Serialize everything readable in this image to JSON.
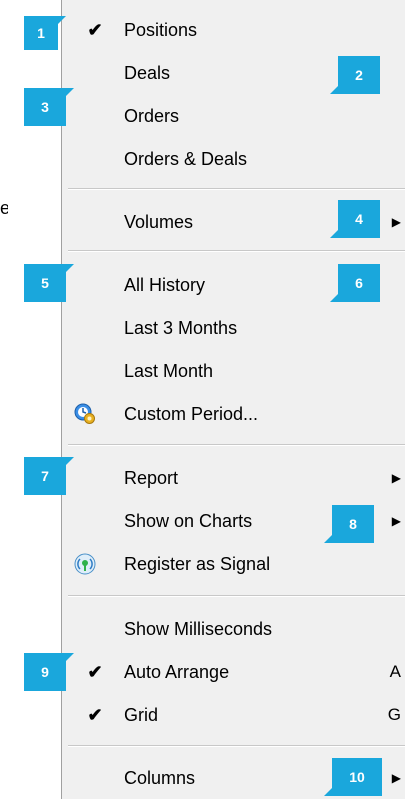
{
  "stray_text": "e",
  "menu": {
    "items": [
      {
        "label": "Positions",
        "checked": true
      },
      {
        "label": "Deals"
      },
      {
        "label": "Orders"
      },
      {
        "label": "Orders & Deals"
      },
      {
        "label": "Volumes",
        "submenu": true
      },
      {
        "label": "All History"
      },
      {
        "label": "Last 3 Months"
      },
      {
        "label": "Last Month"
      },
      {
        "label": "Custom Period...",
        "icon": "custom-period-gear-icon"
      },
      {
        "label": "Report",
        "submenu": true
      },
      {
        "label": "Show on Charts",
        "submenu": true
      },
      {
        "label": "Register as Signal",
        "icon": "signal-broadcast-icon"
      },
      {
        "label": "Show Milliseconds"
      },
      {
        "label": "Auto Arrange",
        "checked": true,
        "shortcut": "A"
      },
      {
        "label": "Grid",
        "checked": true,
        "shortcut": "G"
      },
      {
        "label": "Columns",
        "submenu": true
      }
    ],
    "check_glyph": "✔",
    "submenu_glyph": "▶"
  },
  "callouts": [
    "1",
    "2",
    "3",
    "4",
    "5",
    "6",
    "7",
    "8",
    "9",
    "10"
  ],
  "colors": {
    "callout": "#1aa7dc",
    "menu_bg": "#f0f0f0"
  }
}
